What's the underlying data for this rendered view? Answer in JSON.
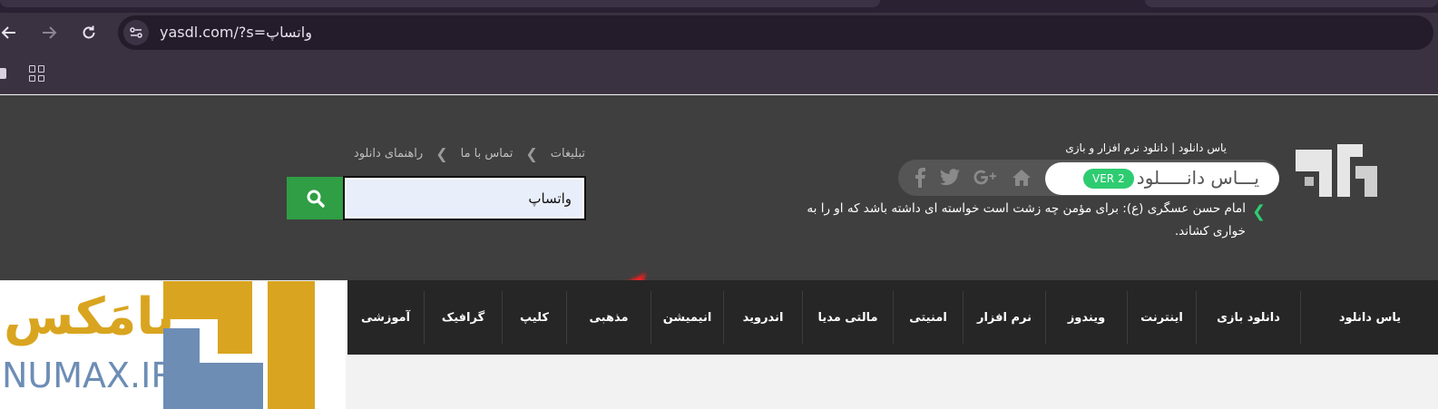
{
  "browser": {
    "url": "yasdl.com/?s=واتساپ",
    "icons": [
      "back-icon",
      "forward-icon",
      "reload-icon",
      "site-info-icon",
      "apps-grid-icon"
    ]
  },
  "header": {
    "tagline": "یاس دانلود | دانلود نرم افزار و بازی",
    "brand_name": "یـــاس دانـــــلود",
    "version_badge": "VER 2",
    "quote": "امام حسن عسگری (ع): برای مؤمن چه زشت است خواسته ای داشته باشد که او را به خواری کشاند.",
    "top_links": [
      "تبلیغات",
      "تماس با ما",
      "راهنمای دانلود"
    ],
    "search_value": "واتساپ",
    "colors": {
      "accent_green": "#2ecc71",
      "search_button": "#2f9e44",
      "header_bg": "#3f3f3f",
      "nav_bg": "#262626"
    }
  },
  "nav": {
    "items": [
      "یاس دانلود",
      "دانلود بازی",
      "اینترنت",
      "ویندوز",
      "نرم افزار",
      "امنیتی",
      "مالتی مدیا",
      "اندروید",
      "انیمیشن",
      "مذهبی",
      "کلیپ",
      "گرافیک",
      "آموزشی"
    ]
  },
  "watermark": {
    "persian": "نامَکس",
    "latin": "NUMAX.IR"
  }
}
